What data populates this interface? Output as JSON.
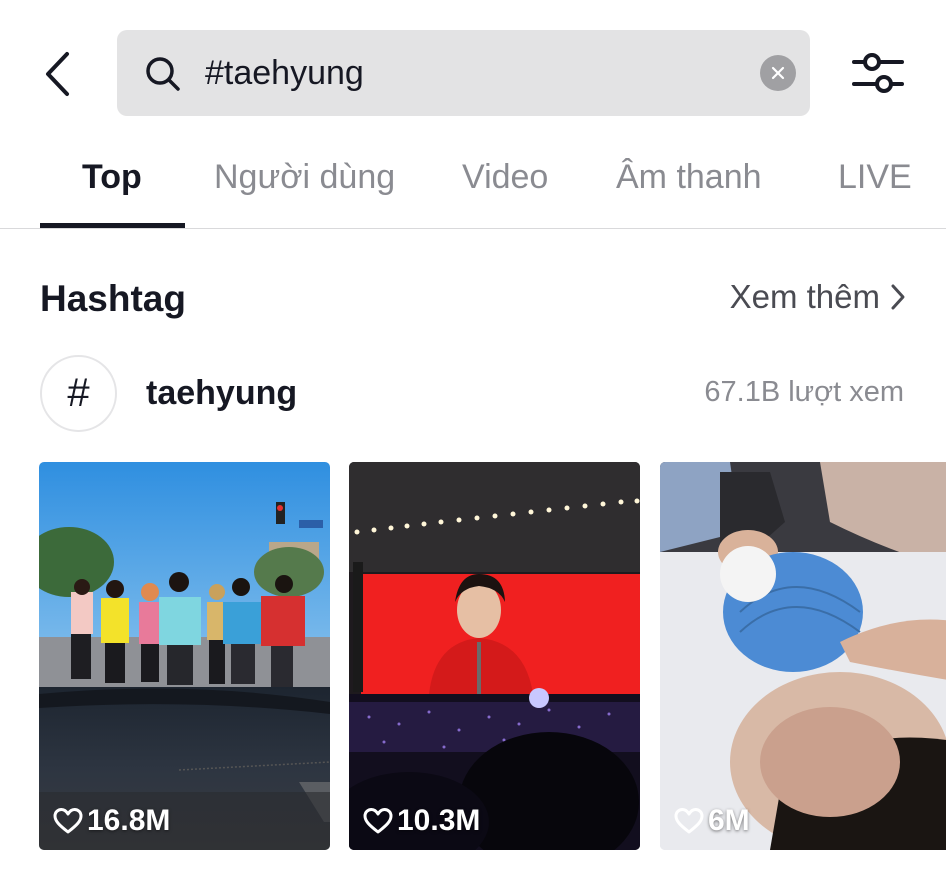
{
  "header": {
    "back_icon": "chevron-left-icon",
    "search": {
      "icon": "search-icon",
      "value": "#taehyung",
      "clear_icon": "clear-icon"
    },
    "filter_icon": "sliders-icon"
  },
  "tabs": [
    {
      "label": "Top",
      "active": true
    },
    {
      "label": "Người dùng",
      "active": false
    },
    {
      "label": "Video",
      "active": false
    },
    {
      "label": "Âm thanh",
      "active": false
    },
    {
      "label": "LIVE",
      "active": false
    }
  ],
  "hashtag_section": {
    "title": "Hashtag",
    "see_more": "Xem thêm",
    "see_more_icon": "chevron-right-icon",
    "item": {
      "symbol": "#",
      "name": "taehyung",
      "views": "67.1B lượt xem"
    }
  },
  "videos": [
    {
      "likes": "16.8M",
      "icon": "heart-icon",
      "description": "group dancing in colorful jackets outside, viewed from car dashboard"
    },
    {
      "likes": "10.3M",
      "icon": "heart-icon",
      "description": "concert screen showing performer in red jacket, crowd with purple lights"
    },
    {
      "likes": "6M",
      "icon": "heart-icon",
      "description": "person lying down with blue ice pack held to head"
    }
  ],
  "colors": {
    "text_primary": "#161823",
    "text_secondary": "#8a8b91",
    "search_bg": "#e3e3e4",
    "clear_bg": "#a0a0a3"
  }
}
